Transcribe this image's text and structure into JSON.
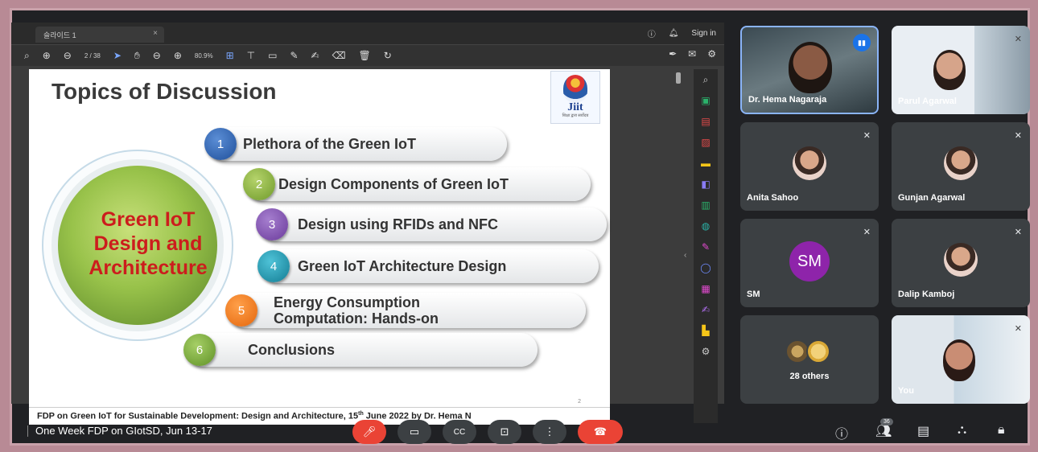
{
  "viewer": {
    "tab_label": "슬라이드 1",
    "tab_close": "×",
    "signin": "Sign in",
    "page_indicator": "2 / 38",
    "zoom": "80.9%",
    "toolbar_icons": [
      "search-icon",
      "up-icon",
      "down-icon",
      "pointer-icon",
      "hand-icon",
      "zoom-out-icon",
      "zoom-in-icon",
      "fit-icon",
      "stamp-icon",
      "comment-icon",
      "pen-icon",
      "highlight-icon",
      "eraser-icon",
      "trash-icon",
      "redo-icon"
    ]
  },
  "slide": {
    "title": "Topics of Discussion",
    "logo_text": "Jiit",
    "logo_sub": "शिक्षा द्वारा सर्वोदय",
    "globe_text": [
      "Green IoT",
      "Design and",
      "Architecture"
    ],
    "topics": [
      {
        "num": "1",
        "text": "Plethora of the Green IoT"
      },
      {
        "num": "2",
        "text": "Design Components of Green IoT"
      },
      {
        "num": "3",
        "text": "Design using RFIDs and NFC"
      },
      {
        "num": "4",
        "text": "Green IoT Architecture Design"
      },
      {
        "num": "5",
        "text": "Energy Consumption Computation: Hands-on"
      },
      {
        "num": "6",
        "text": "Conclusions"
      }
    ],
    "topic5_lines": [
      "Energy Consumption",
      "Computation: Hands-on"
    ],
    "footer_pre": "FDP on Green IoT for Sustainable Development: Design and Architecture, 15",
    "footer_sup": "th",
    "footer_post": " June 2022 by Dr. Hema N",
    "page_number": "2"
  },
  "participants": [
    {
      "name": "Dr. Hema Nagaraja",
      "type": "video"
    },
    {
      "name": "Parul Agarwal",
      "type": "video"
    },
    {
      "name": "Anita Sahoo",
      "type": "photo"
    },
    {
      "name": "Gunjan Agarwal",
      "type": "photo"
    },
    {
      "name": "SM",
      "type": "initials",
      "initials": "SM"
    },
    {
      "name": "Dalip Kamboj",
      "type": "photo"
    },
    {
      "name": "28 others",
      "type": "others"
    },
    {
      "name": "You",
      "type": "video"
    }
  ],
  "bottombar": {
    "meeting_title": "One Week FDP on GIotSD, Jun 13-17",
    "people_count": "36"
  },
  "colors": {
    "accent": "#1a73e8",
    "danger": "#ea4335",
    "frame": "#c9a1aa",
    "globe_text": "#cc1d1d"
  }
}
